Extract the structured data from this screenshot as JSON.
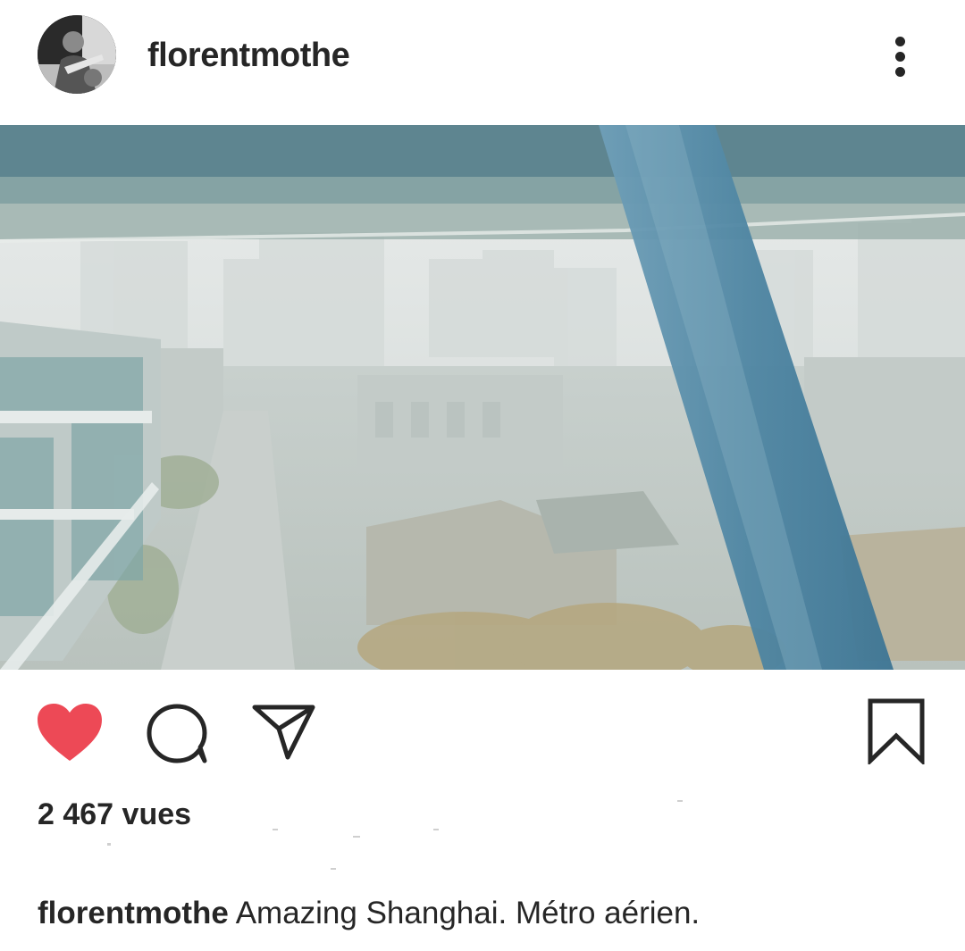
{
  "post": {
    "username": "florentmothe",
    "views": "2 467 vues",
    "caption": {
      "author": "florentmothe",
      "text": "Amazing Shanghai. Métro aérien."
    }
  },
  "icons": {
    "more": "more-vertical-icon",
    "like": "heart-filled-icon",
    "comment": "comment-bubble-icon",
    "share": "paper-plane-icon",
    "save": "bookmark-icon"
  },
  "colors": {
    "like": "#ed4956",
    "text": "#262626"
  }
}
